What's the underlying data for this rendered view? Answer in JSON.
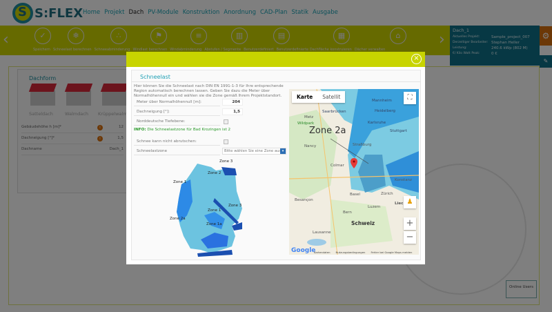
{
  "brand": "S:FLEX",
  "nav": [
    "Home",
    "Projekt",
    "Dach",
    "PV-Module",
    "Konstruktion",
    "Anordnung",
    "CAD-Plan",
    "Statik",
    "Ausgabe"
  ],
  "nav_active": "Dach",
  "toolbar": [
    "Speichern",
    "Schneelast berechnen",
    "Schneeabminderung",
    "Windlast berechnen",
    "Windabminderung",
    "Abstufen / Segmente",
    "Benutzerdefiniert",
    "Benutzerdefinierte Dachfläche konstruieren",
    "Dächer verwalten"
  ],
  "info": {
    "roof": "Dach_1",
    "rows": [
      {
        "k": "Aktuelles Projekt:",
        "v": "Sample_project_007"
      },
      {
        "k": "Derzeitiger Bearbeiter:",
        "v": "Stephan Heller"
      },
      {
        "k": "Leistung:",
        "v": "240.6 kWp (802 M)"
      },
      {
        "k": "€/ Kilo Watt Peak:",
        "v": "0 €"
      }
    ]
  },
  "dachform": {
    "title": "Dachform",
    "types": [
      "Satteldach",
      "Walmdach",
      "Krüppelwalmdach"
    ],
    "fields": [
      {
        "label": "Gebäudehöhe h [m]*",
        "value": "12"
      },
      {
        "label": "Dachneigung [°]*",
        "value": "1,5"
      },
      {
        "label": "Dachname",
        "value": "Dach_1"
      }
    ]
  },
  "online_users": "Online Users",
  "modal": {
    "close": "×",
    "title": "Schneelast",
    "description": "Hier können Sie die Schneelast nach DIN EN 1991-1-3 für Ihre entsprechende Region automatisch berechnen lassen. Geben Sie dazu die Meter über Normalhöhennull ein und wählen sie die Zone gemäß Ihrem Projektstandort.",
    "height_label": "Meter über Normalhöhennull [m]:",
    "height_value": "204",
    "slope_label": "Dachneigung [°]:",
    "slope_value": "1,5",
    "lowland_label": "Norddeutsche Tiefebene:",
    "info_prefix": "INFO:",
    "info_text": "Die Schneelastzone für Bad Krozingen ist 2",
    "slide_label": "Schnee kann nicht abrutschen:",
    "zone_label": "Schneelastzone",
    "zone_placeholder": "Bitte wählen Sie eine Zone aus",
    "zonemap_labels": [
      "Zone 3",
      "Zone 2",
      "Zone 1",
      "Zone 1",
      "Zone 3",
      "Zone 2a",
      "Zone 1a"
    ],
    "map": {
      "tab_map": "Karte",
      "tab_sat": "Satellit",
      "zone": "Zone 2a",
      "places": [
        "Metz",
        "Wildpark",
        "Nancy",
        "Saarbrücken",
        "Mannheim",
        "Heidelberg",
        "Karlsruhe",
        "Stuttgart",
        "Straßburg",
        "Colmar",
        "Basel",
        "Zürich",
        "Konstanz",
        "Besançon",
        "Luzern",
        "Bern",
        "Schweiz",
        "Lausanne",
        "Liec"
      ],
      "footer": [
        "Kartendaten",
        "Nutzungsbedingungen",
        "Fehler bei Google Maps melden"
      ],
      "google": "Google"
    }
  }
}
